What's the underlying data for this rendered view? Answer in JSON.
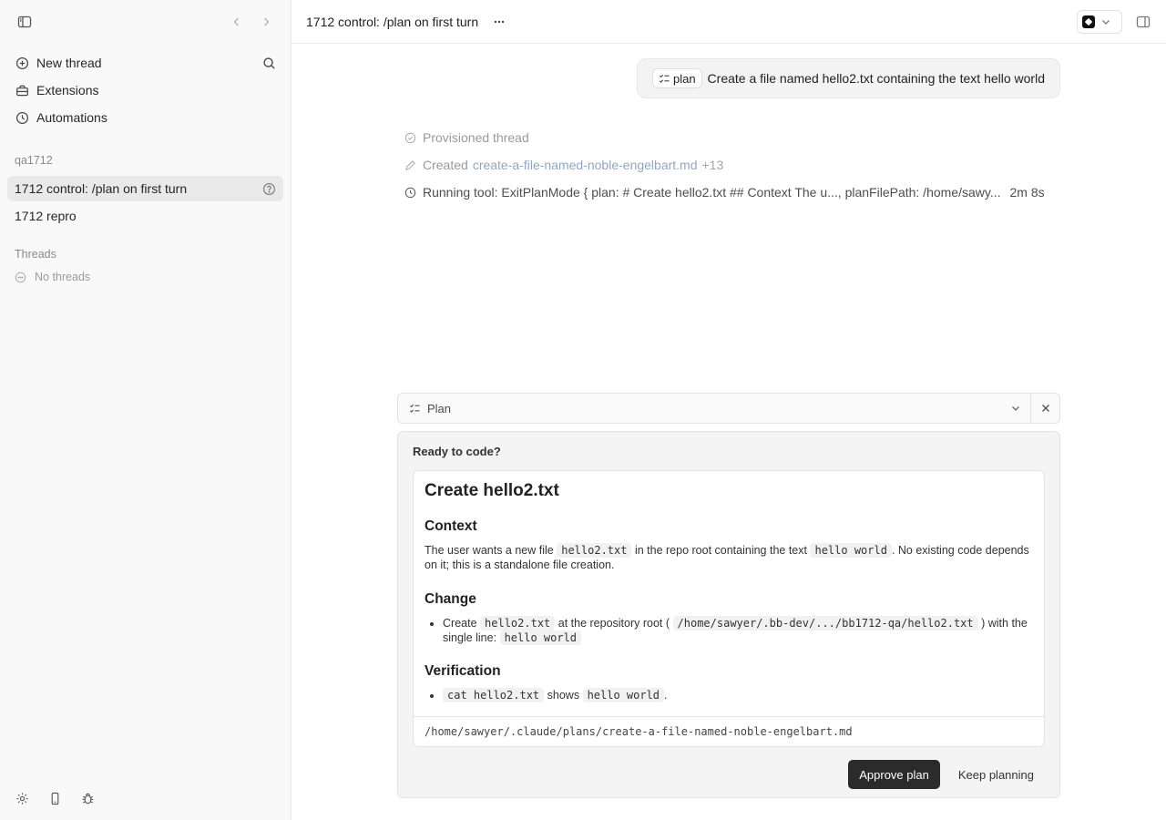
{
  "sidebar": {
    "menu": [
      {
        "label": "New thread",
        "icon": "plus-circle-icon"
      },
      {
        "label": "Extensions",
        "icon": "toolbox-icon"
      },
      {
        "label": "Automations",
        "icon": "clock-icon"
      }
    ],
    "workspace_label": "qa1712",
    "workspace_threads": [
      {
        "label": "1712 control: /plan on first turn",
        "active": true
      },
      {
        "label": "1712 repro",
        "active": false
      }
    ],
    "threads_label": "Threads",
    "no_threads_label": "No threads"
  },
  "topbar": {
    "title": "1712 control: /plan on first turn"
  },
  "user_message": {
    "chip_label": "plan",
    "text": "Create a file named hello2.txt containing the text hello world"
  },
  "activity": [
    {
      "text": "Provisioned thread"
    },
    {
      "text": "Created",
      "link": "create-a-file-named-noble-engelbart.md",
      "extra": "+13"
    },
    {
      "text": "Running tool: ExitPlanMode { plan: # Create hello2.txt ## Context The u..., planFilePath: /home/sawy...",
      "time": "2m 8s"
    }
  ],
  "plan_bar": {
    "label": "Plan"
  },
  "ready": {
    "title": "Ready to code?",
    "doc": {
      "h1": "Create hello2.txt",
      "context_heading": "Context",
      "context_p1": "The user wants a new file",
      "context_code1": "hello2.txt",
      "context_p2": "in the repo root containing the text",
      "context_code2": "hello world",
      "context_p3": ". No existing code depends on it; this is a standalone file creation.",
      "change_heading": "Change",
      "change_t1": "Create",
      "change_code1": "hello2.txt",
      "change_t2": "at the repository root (",
      "change_code2": "/home/sawyer/.bb-dev/.../bb1712-qa/hello2.txt",
      "change_t3": ") with the single line:",
      "change_code3": "hello world",
      "verify_heading": "Verification",
      "verify_code1": "cat hello2.txt",
      "verify_t1": "shows",
      "verify_code2": "hello world",
      "verify_t2": ".",
      "footer_path": "/home/sawyer/.claude/plans/create-a-file-named-noble-engelbart.md"
    },
    "approve_label": "Approve plan",
    "keep_label": "Keep planning"
  }
}
